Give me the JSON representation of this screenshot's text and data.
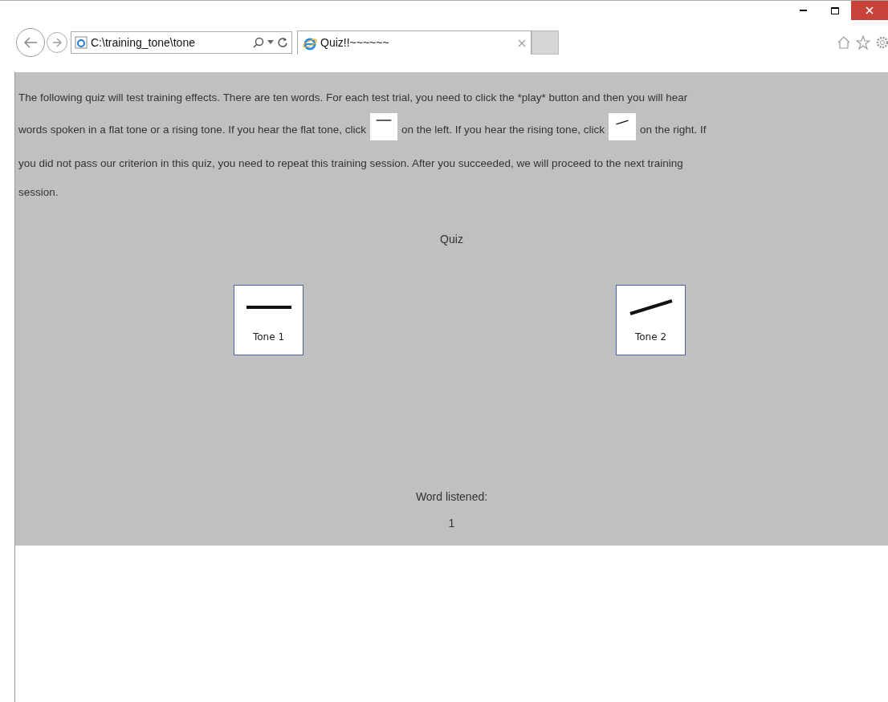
{
  "browser": {
    "address": "C:\\training_tone\\tone",
    "tabs": [
      {
        "title": "Quiz!!~~~~~~",
        "selected": true
      }
    ]
  },
  "intro": {
    "lines": [
      [
        {
          "kind": "text",
          "text": "The following quiz will test training effects. There are ten words. For each test trial, you need to click the *play* button and then you will hear"
        }
      ],
      [
        {
          "kind": "text",
          "text": "words spoken in a flat tone or a rising tone. If you hear the flat tone, click"
        },
        {
          "kind": "flat_image"
        },
        {
          "kind": "text",
          "text": "on the left. If you hear the rising tone, click"
        },
        {
          "kind": "rising_image"
        },
        {
          "kind": "text",
          "text": "on the right. If"
        }
      ],
      [
        {
          "kind": "text",
          "text": "you did not pass our criterion in this quiz, you need to repeat this training session. After you succeeded, we will proceed to the next training"
        }
      ],
      [
        {
          "kind": "text",
          "text": "session."
        }
      ]
    ]
  },
  "quiz": {
    "title": "Quiz",
    "buttons": [
      {
        "label": "Tone 1",
        "kind": "flat"
      },
      {
        "label": "Tone 2",
        "kind": "rising"
      }
    ],
    "counter_label": "Word listened:",
    "counter_value": "1"
  }
}
